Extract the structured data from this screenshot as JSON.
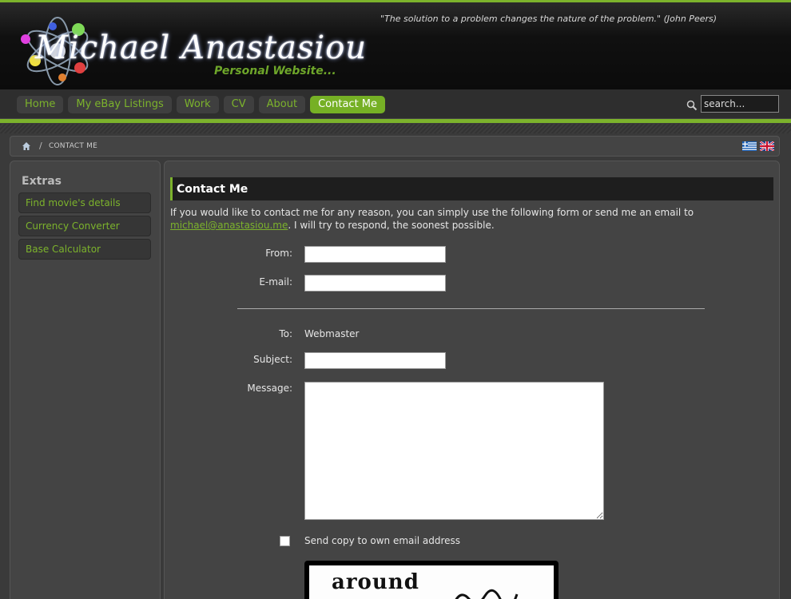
{
  "header": {
    "name": "Michael  Anastasiou",
    "subtitle": "Personal Website...",
    "quote": "\"The solution to a problem changes the nature of the problem.\" (John Peers)"
  },
  "nav": {
    "items": [
      "Home",
      "My eBay Listings",
      "Work",
      "CV",
      "About",
      "Contact Me"
    ],
    "active": "Contact Me"
  },
  "search": {
    "placeholder": "search..."
  },
  "breadcrumb": {
    "separator": "/",
    "current": "CONTACT ME"
  },
  "sidebar": {
    "title": "Extras",
    "items": [
      "Find movie's details",
      "Currency Converter",
      "Base Calculator"
    ]
  },
  "content": {
    "title": "Contact Me",
    "intro_before": "If you would like to contact me for any reason, you can simply use the following form or send me an email to ",
    "email": "michael@anastasiou.me",
    "intro_after": ". I will try to respond, the soonest possible."
  },
  "form": {
    "from_label": "From:",
    "email_label": "E-mail:",
    "to_label": "To:",
    "to_value": "Webmaster",
    "subject_label": "Subject:",
    "message_label": "Message:",
    "copy_label": "Send copy to own email address",
    "captcha_word": "around"
  },
  "colors": {
    "accent": "#7cb32c",
    "active_tab": "#76b025"
  }
}
